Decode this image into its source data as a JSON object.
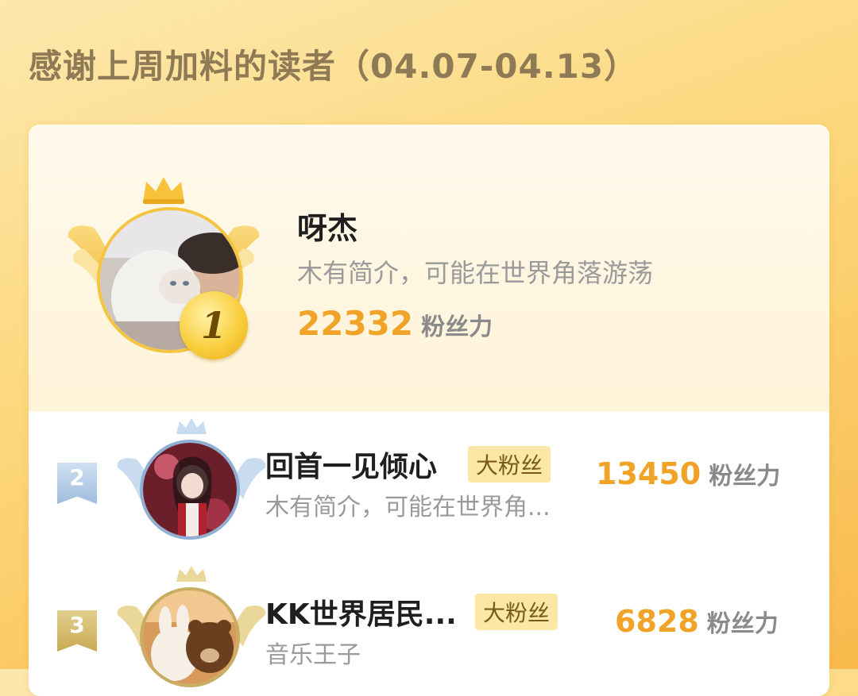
{
  "page": {
    "title": "感谢上周加料的读者（04.07-04.13）"
  },
  "colors": {
    "accent_score": "#f0a327",
    "gold": "#f9cf3e",
    "silver": "#9fbcdc",
    "bronze": "#c8aa55"
  },
  "top_reader": {
    "rank": "1",
    "name": "呀杰",
    "intro": "木有简介，可能在世界角落游荡",
    "score": "22332",
    "score_unit": "粉丝力",
    "icons": [
      "crown-icon",
      "wings-icon"
    ]
  },
  "readers": [
    {
      "rank": "2",
      "name": "回首一见倾心",
      "tag": "大粉丝",
      "intro": "木有简介，可能在世界角...",
      "score": "13450",
      "score_unit": "粉丝力"
    },
    {
      "rank": "3",
      "name": "KK世界居民...",
      "tag": "大粉丝",
      "intro": "音乐王子",
      "score": "6828",
      "score_unit": "粉丝力"
    }
  ]
}
